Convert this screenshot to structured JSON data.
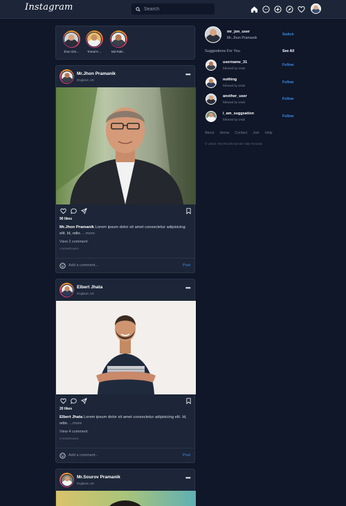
{
  "nav": {
    "logo": "Instagram",
    "search_placeholder": "Search",
    "icons": [
      "home-icon",
      "messenger-icon",
      "add-post-icon",
      "explore-icon",
      "heart-icon"
    ]
  },
  "stories": [
    {
      "name": "Jhon Om..."
    },
    {
      "name": "Tomal K..."
    },
    {
      "name": "Md Raki..."
    }
  ],
  "posts": [
    {
      "user": "Mr.Jhon Pramanik",
      "location": "England, UK",
      "likes": "90 likes",
      "caption_user": "Mr.Jhon Pramanik",
      "caption_text": "Lorem ipsum dolor sit amet consectetur adipisicing elit. Id, odio.",
      "more": "...more",
      "view_comments": "View 2 comment",
      "time": "1 hours ago",
      "comment_placeholder": "Add a comment...",
      "post_label": "Post"
    },
    {
      "user": "Elbert Jhata",
      "location": "England, UK",
      "likes": "20 likes",
      "caption_user": "Elbert Jhata",
      "caption_text": "Lorem ipsum dolor sit amet consectetur adipisicing elit. Id, odio.",
      "more": "...more",
      "view_comments": "View 4 comment",
      "time": "2 hours ago",
      "comment_placeholder": "Add a comment...",
      "post_label": "Post"
    },
    {
      "user": "Mr.Sourov Pramanik",
      "location": "England, UK"
    }
  ],
  "sidebar": {
    "username": "mr_jon_user",
    "fullname": "Mr..Jhon Pramanik",
    "switch_label": "Switch",
    "suggestions_title": "Suggestions For You",
    "see_all_label": "See All",
    "suggestions": [
      {
        "username": "username_31",
        "followed_by": "followed by omuk",
        "follow": "Follow"
      },
      {
        "username": "nothing",
        "followed_by": "followed by omuk",
        "follow": "Follow"
      },
      {
        "username": "another_user",
        "followed_by": "followed by omuk",
        "follow": "Follow"
      },
      {
        "username": "i_am_suggsation",
        "followed_by": "followed by omuk",
        "follow": "Follow"
      }
    ],
    "links": [
      "About",
      "Home",
      "Contact",
      "Join",
      "Help"
    ],
    "copyright": "© 2022 INSTAGRAM BY MD RAKIB"
  },
  "colors": {
    "background": "#0f1729",
    "card": "#1c2638",
    "accent": "#3f8ae0"
  }
}
